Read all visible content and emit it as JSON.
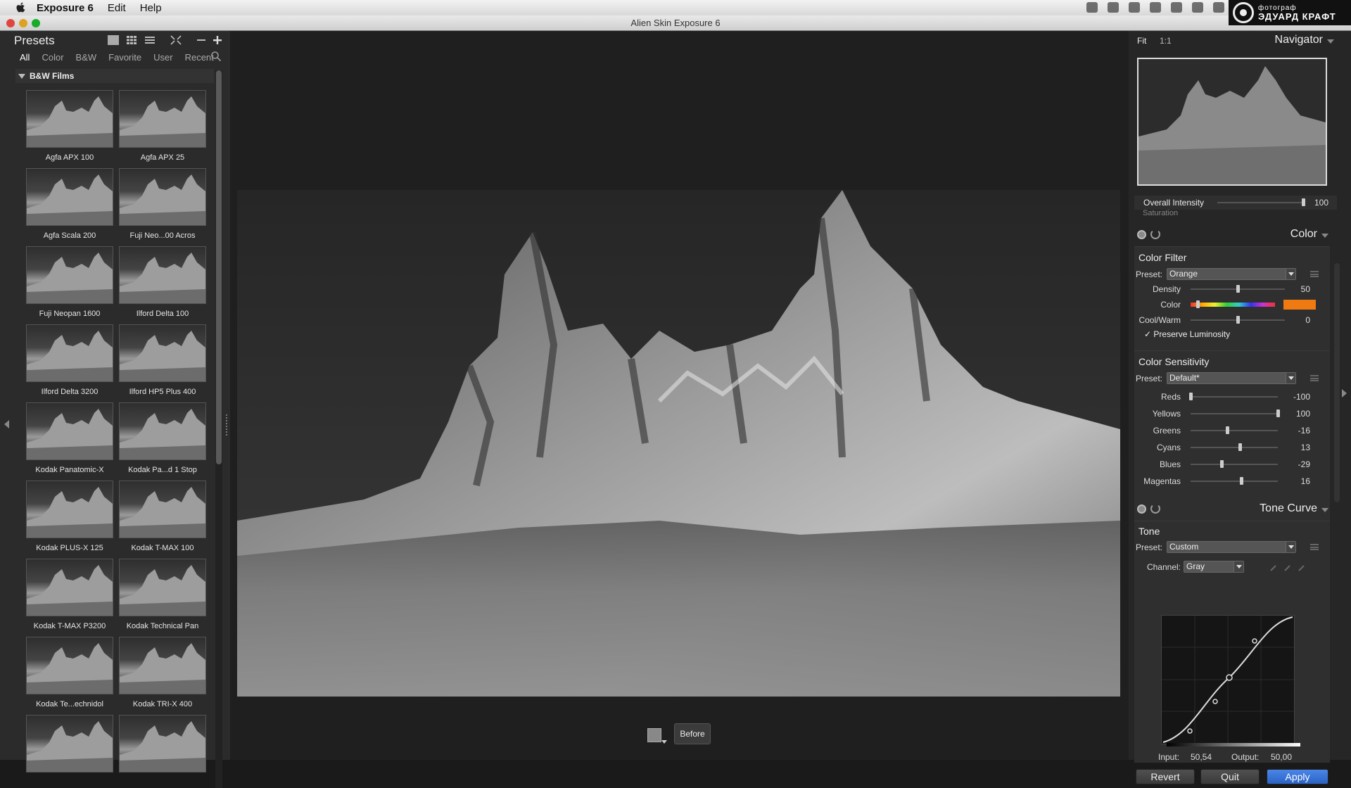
{
  "menubar": {
    "app_name": "Exposure 6",
    "items": [
      "Edit",
      "Help"
    ]
  },
  "watermark": {
    "line1": "фотограф",
    "line2": "ЭДУАРД КРАФТ"
  },
  "window": {
    "title": "Alien Skin Exposure 6"
  },
  "presets": {
    "title": "Presets",
    "tabs": [
      "All",
      "Color",
      "B&W",
      "Favorite",
      "User",
      "Recent"
    ],
    "active_tab": "All",
    "group": "B&W Films",
    "items": [
      "Agfa APX 100",
      "Agfa APX 25",
      "Agfa Scala 200",
      "Fuji Neo...00 Acros",
      "Fuji Neopan 1600",
      "Ilford Delta 100",
      "Ilford Delta 3200",
      "Ilford HP5 Plus 400",
      "Kodak Panatomic-X",
      "Kodak Pa...d 1 Stop",
      "Kodak PLUS-X 125",
      "Kodak T-MAX 100",
      "Kodak T-MAX P3200",
      "Kodak Technical Pan",
      "Kodak Te...echnidol",
      "Kodak TRI-X 400",
      "",
      ""
    ]
  },
  "canvas": {
    "before_label": "Before"
  },
  "navigator": {
    "fit": "Fit",
    "one_to_one": "1:1",
    "title": "Navigator",
    "overall_intensity_label": "Overall Intensity",
    "overall_intensity_value": "100",
    "overall_intensity_level": 1.0,
    "saturation_ghost": "Saturation"
  },
  "color_section": {
    "title": "Color",
    "filter": {
      "title": "Color Filter",
      "preset_label": "Preset:",
      "preset_value": "Orange",
      "density_label": "Density",
      "density_value": "50",
      "density_level": 0.5,
      "color_label": "Color",
      "color_level": 0.08,
      "swatch_color": "#f07a12",
      "coolwarm_label": "Cool/Warm",
      "coolwarm_value": "0",
      "coolwarm_level": 0.5,
      "preserve_label": "Preserve Luminosity",
      "preserve_checked": true
    },
    "sensitivity": {
      "title": "Color Sensitivity",
      "preset_label": "Preset:",
      "preset_value": "Default*",
      "sliders": [
        {
          "label": "Reds",
          "value": "-100",
          "level": 0.0
        },
        {
          "label": "Yellows",
          "value": "100",
          "level": 1.0
        },
        {
          "label": "Greens",
          "value": "-16",
          "level": 0.42
        },
        {
          "label": "Cyans",
          "value": "13",
          "level": 0.565
        },
        {
          "label": "Blues",
          "value": "-29",
          "level": 0.355
        },
        {
          "label": "Magentas",
          "value": "16",
          "level": 0.58
        }
      ]
    }
  },
  "tone_section": {
    "title": "Tone Curve",
    "tone": {
      "title": "Tone",
      "preset_label": "Preset:",
      "preset_value": "Custom",
      "channel_label": "Channel:",
      "channel_value": "Gray",
      "input_label": "Input:",
      "input_value": "50,54",
      "output_label": "Output:",
      "output_value": "50,00"
    }
  },
  "buttons": {
    "revert": "Revert",
    "quit": "Quit",
    "apply": "Apply"
  },
  "colors": {
    "accent": "#2b63c4",
    "panel": "#2f2f2f"
  }
}
